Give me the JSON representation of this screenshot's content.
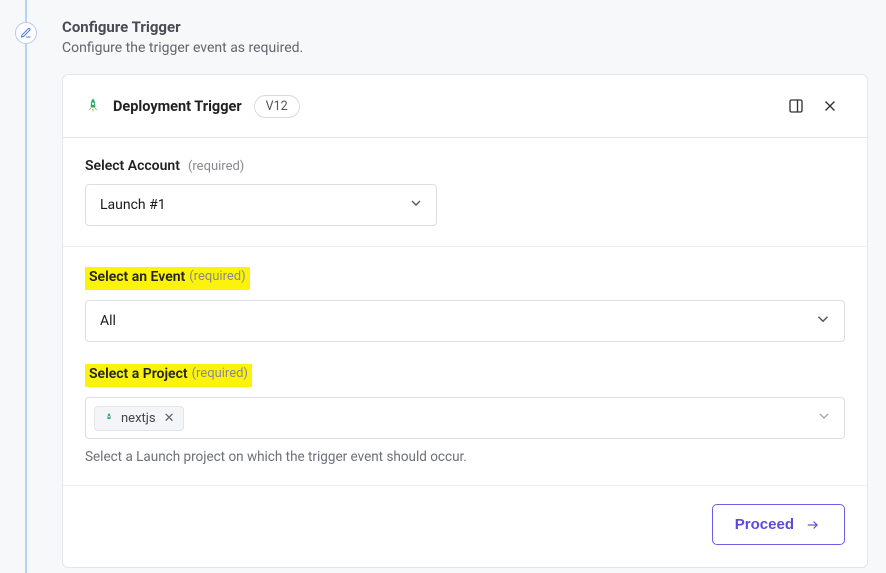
{
  "section": {
    "title": "Configure Trigger",
    "subtitle": "Configure the trigger event as required."
  },
  "card": {
    "title": "Deployment Trigger",
    "version": "V12"
  },
  "account": {
    "label": "Select Account",
    "required": "(required)",
    "value": "Launch #1"
  },
  "event": {
    "label": "Select an Event",
    "required": "(required)",
    "value": "All"
  },
  "project": {
    "label": "Select a Project",
    "required": "(required)",
    "tag": "nextjs",
    "help": "Select a Launch project on which the trigger event should occur."
  },
  "footer": {
    "proceed": "Proceed"
  }
}
